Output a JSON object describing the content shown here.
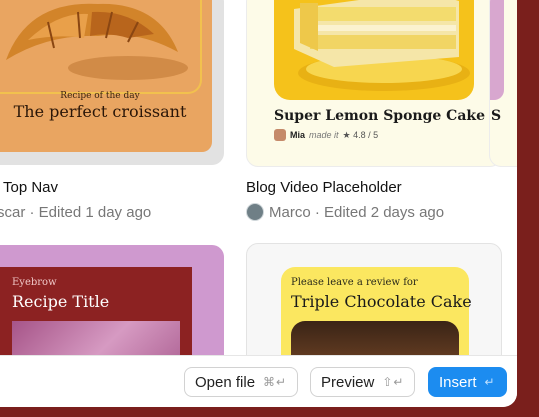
{
  "cards": {
    "croissant": {
      "eyebrow": "Recipe of the day",
      "title": "The perfect croissant",
      "name": "Top Nav",
      "meta": "scar · Edited 1 day ago"
    },
    "lemon": {
      "title": "Super Lemon Sponge Cake",
      "author": "Mia",
      "made": "made it",
      "rating": "★ 4.8 / 5",
      "name": "Blog Video Placeholder",
      "meta": "Marco · Edited 2 days ago"
    },
    "peek": {
      "title": "S"
    },
    "recipe": {
      "eyebrow": "Eyebrow",
      "title": "Recipe Title"
    },
    "chocolate": {
      "eyebrow": "Please leave a review for",
      "title": "Triple Chocolate Cake"
    }
  },
  "footer": {
    "open_label": "Open file",
    "open_shortcut": "⌘↵",
    "preview_label": "Preview",
    "preview_shortcut": "⇧↵",
    "insert_label": "Insert",
    "insert_shortcut": "↵"
  },
  "colors": {
    "backdrop": "#7a1f1c",
    "accent": "#1c8cf0",
    "lemon_bg": "#f5c21b",
    "pink_card": "#cf99cf",
    "recipe_red": "#8c2222",
    "choc_yellow": "#fbe760"
  }
}
